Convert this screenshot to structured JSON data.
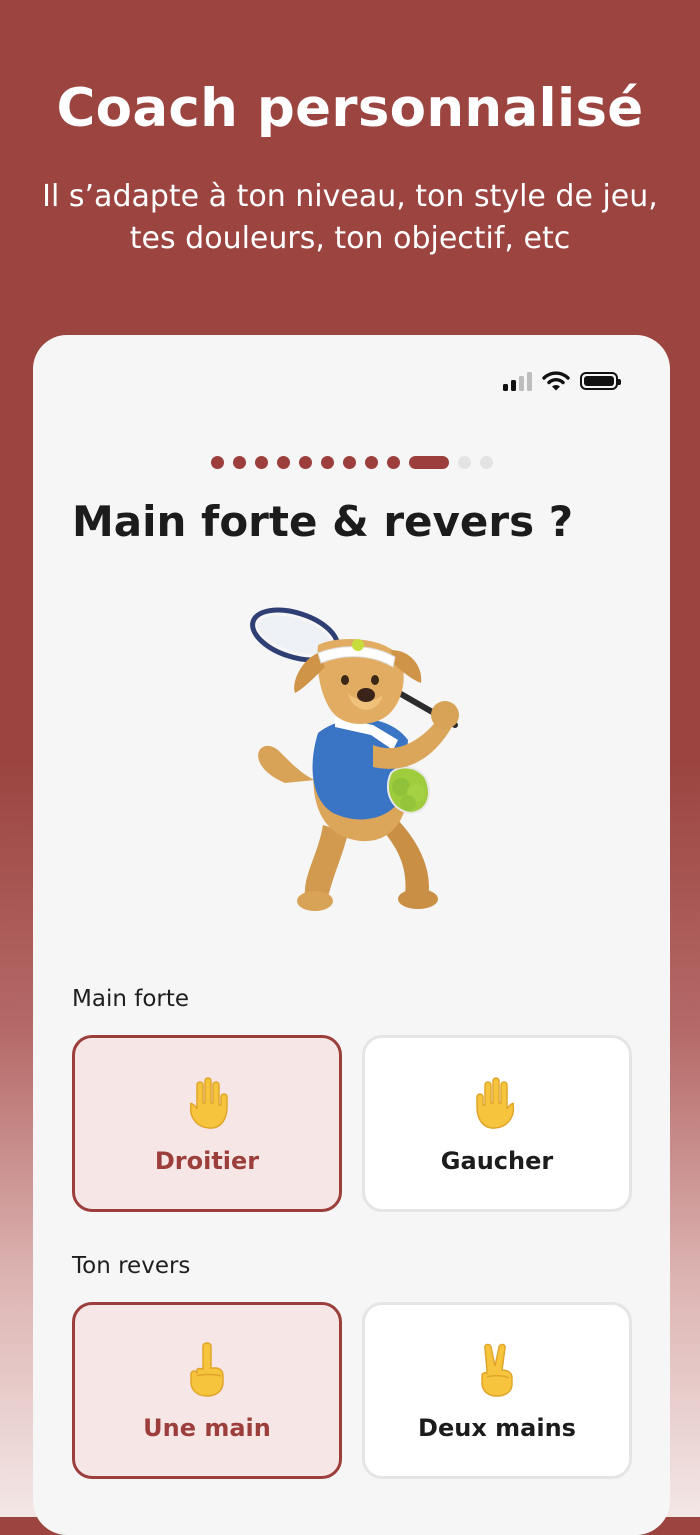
{
  "promo": {
    "title": "Coach personnalisé",
    "subtitle": "Il s’adapte à ton niveau, ton style de jeu, tes douleurs, ton objectif, etc"
  },
  "status_bar": {
    "icons": [
      "cellular-signal-icon",
      "wifi-icon",
      "battery-icon"
    ]
  },
  "progress": {
    "total_steps": 12,
    "current_step": 10
  },
  "question": {
    "title": "Main forte & revers ?"
  },
  "mascot": {
    "description_icon": "dog-tennis-player-illustration"
  },
  "main_forte": {
    "label": "Main forte",
    "options": [
      {
        "label": "Droitier",
        "icon": "raised-hand-icon",
        "selected": true
      },
      {
        "label": "Gaucher",
        "icon": "raised-hand-icon",
        "selected": false
      }
    ]
  },
  "revers": {
    "label": "Ton revers",
    "options": [
      {
        "label": "Une main",
        "icon": "index-pointing-up-icon",
        "selected": true
      },
      {
        "label": "Deux mains",
        "icon": "victory-hand-icon",
        "selected": false
      }
    ]
  },
  "colors": {
    "brand": "#9c3f3c",
    "background": "#9b4440",
    "selected_fill": "#f7e6e6",
    "progress_inactive": "#e3e3e3",
    "hand_yellow": "#f7c43d"
  }
}
